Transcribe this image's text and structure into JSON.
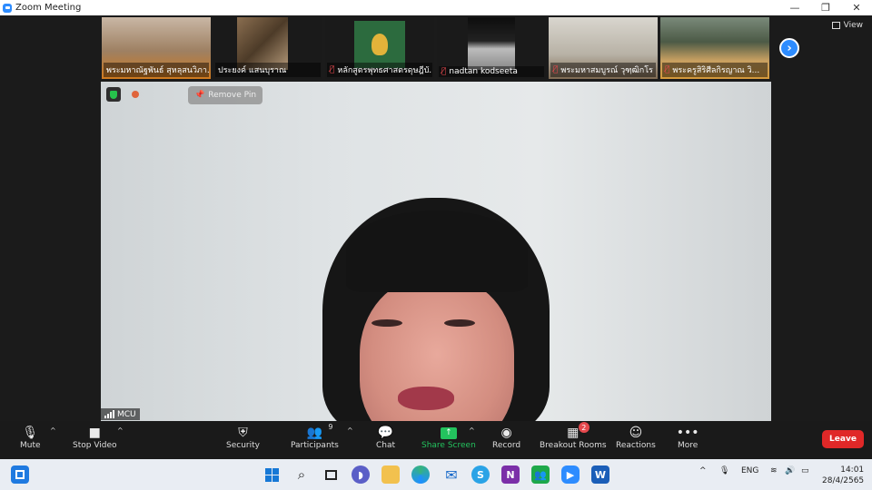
{
  "window": {
    "title": "Zoom Meeting",
    "controls": {
      "minimize": "—",
      "restore": "❐",
      "close": "✕"
    }
  },
  "gallery": {
    "participants": [
      {
        "name": "พระมหาณัฐพันธ์ สุหลุสนวิภา...",
        "muted": false
      },
      {
        "name": "ประยงค์ แสนบุราณ",
        "muted": false
      },
      {
        "name": "หลักสูตรพุทธศาสตรดุษฎีบั...",
        "muted": true
      },
      {
        "name": "nadtan kodseeta",
        "muted": true
      },
      {
        "name": "พระมหาสมบูรณ์ วุฑฺฒิกโร",
        "muted": true
      },
      {
        "name": "พระครูสิริศีลกิรญาณ วิ...",
        "muted": true
      }
    ],
    "next_arrow": "›"
  },
  "view_button": {
    "label": "View"
  },
  "main_video": {
    "remove_pin_label": "Remove Pin",
    "label": "MCU"
  },
  "toolbar": {
    "mute": "Mute",
    "stop_video": "Stop Video",
    "security": "Security",
    "participants": "Participants",
    "participants_count": "9",
    "chat": "Chat",
    "share_screen": "Share Screen",
    "record": "Record",
    "breakout_rooms": "Breakout Rooms",
    "breakout_badge": "2",
    "reactions": "Reactions",
    "more": "More",
    "leave": "Leave"
  },
  "taskbar": {
    "language": "ENG",
    "time": "14:01",
    "date": "28/4/2565"
  },
  "colors": {
    "zoom_blue": "#2d8cff",
    "share_green": "#23c35e",
    "leave_red": "#e02828"
  }
}
